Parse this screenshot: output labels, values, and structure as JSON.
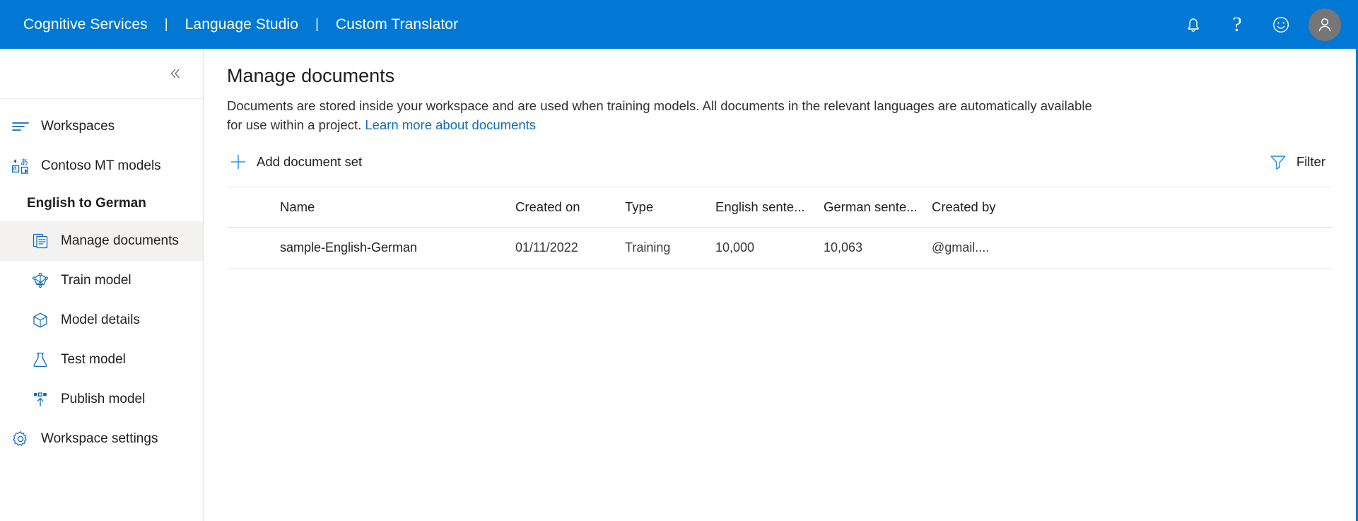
{
  "header": {
    "brand_items": [
      {
        "label": "Cognitive Services",
        "name": "cognitive-services"
      },
      {
        "label": "Language Studio",
        "name": "language-studio"
      },
      {
        "label": "Custom Translator",
        "name": "custom-translator"
      }
    ],
    "separator": "|",
    "background_color": "#0078d4",
    "icons": [
      {
        "name": "notifications-bell-icon",
        "glyph": "bell"
      },
      {
        "name": "help-question-icon",
        "glyph": "?"
      },
      {
        "name": "feedback-smiley-icon",
        "glyph": "smiley"
      },
      {
        "name": "account-avatar-icon",
        "glyph": "person"
      }
    ]
  },
  "sidebar": {
    "collapse_button": {
      "name": "collapse-sidebar-button",
      "glyph": "«"
    },
    "items": [
      {
        "label": "Workspaces",
        "icon": "list-lines-icon",
        "selected": false,
        "indented": false
      },
      {
        "label": "Contoso MT models",
        "icon": "translate-icon",
        "selected": false,
        "indented": false
      }
    ],
    "group_title": "English to German",
    "sub_items": [
      {
        "label": "Manage documents",
        "icon": "documents-icon",
        "selected": true,
        "indented": true
      },
      {
        "label": "Train model",
        "icon": "neural-network-icon",
        "selected": false,
        "indented": true
      },
      {
        "label": "Model details",
        "icon": "package-cube-icon",
        "selected": false,
        "indented": true
      },
      {
        "label": "Test model",
        "icon": "flask-icon",
        "selected": false,
        "indented": true
      },
      {
        "label": "Publish model",
        "icon": "publish-upload-icon",
        "selected": false,
        "indented": true
      }
    ],
    "footer_items": [
      {
        "label": "Workspace settings",
        "icon": "gear-icon",
        "selected": false,
        "indented": false
      }
    ]
  },
  "main": {
    "title": "Manage documents",
    "description_part1": "Documents are stored inside your workspace and are used when training models. All documents in the relevant languages are automatically available for use within a project. ",
    "description_link": "Learn more about documents",
    "add_button_label": "Add document set",
    "add_button_icon": "plus-icon",
    "filter_button_label": "Filter",
    "filter_button_icon": "funnel-filter-icon",
    "accent_color": "#0f6cbd"
  },
  "table": {
    "columns": [
      "Name",
      "Created on",
      "Type",
      "English sente...",
      "German sente...",
      "Created by"
    ],
    "rows": [
      {
        "name": "sample-English-German",
        "created_on": "01/11/2022",
        "type": "Training",
        "english_sentences": "10,000",
        "german_sentences": "10,063",
        "created_by": "@gmail...."
      }
    ]
  }
}
